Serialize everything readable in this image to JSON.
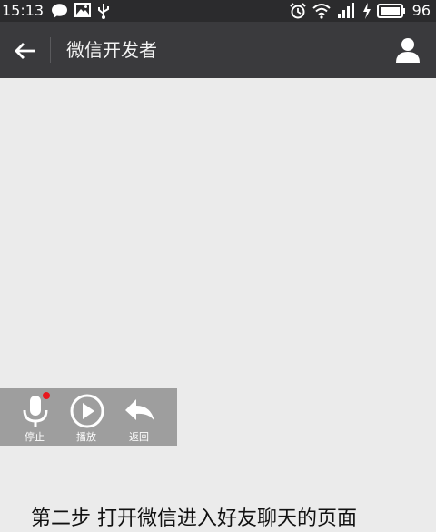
{
  "status_bar": {
    "time": "15:13",
    "battery": "96",
    "icons": [
      "chat-bubble-icon",
      "image-icon",
      "usb-icon",
      "alarm-icon",
      "wifi-icon",
      "signal-icon",
      "charging-icon",
      "battery-icon"
    ]
  },
  "header": {
    "title": "微信开发者",
    "back_icon": "arrow-left-icon",
    "profile_icon": "person-icon"
  },
  "voice_toolbar": {
    "stop_label": "停止",
    "play_label": "播放",
    "back_label": "返回",
    "recording_dot_color": "#e8171e"
  },
  "bottom_caption": "第二步 打开微信进入好友聊天的页面"
}
